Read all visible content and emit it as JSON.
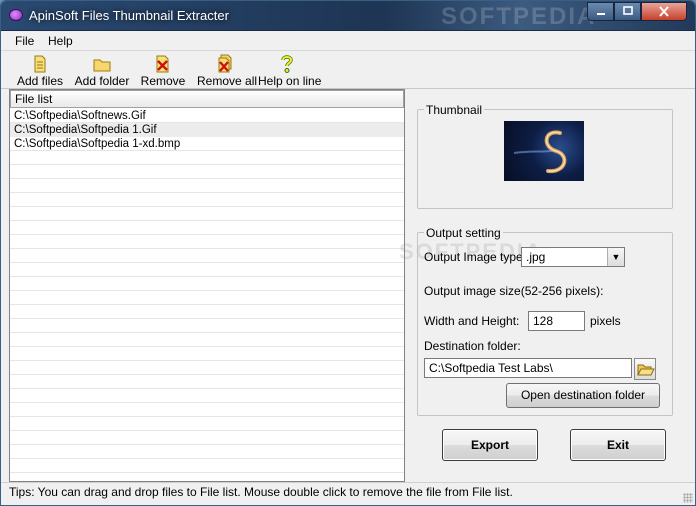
{
  "window": {
    "title": "ApinSoft Files Thumbnail Extracter",
    "watermark": "SOFTPEDIA"
  },
  "menu": {
    "items": [
      {
        "label": "File"
      },
      {
        "label": "Help"
      }
    ]
  },
  "toolbar": {
    "add_files": "Add files",
    "add_folder": "Add folder",
    "remove": "Remove",
    "remove_all": "Remove all",
    "help_online": "Help on line"
  },
  "filelist": {
    "header": "File list",
    "rows": [
      "C:\\Softpedia\\Softnews.Gif",
      "C:\\Softpedia\\Softpedia 1.Gif",
      "C:\\Softpedia\\Softpedia 1-xd.bmp"
    ]
  },
  "thumbnail": {
    "title": "Thumbnail"
  },
  "output": {
    "title": "Output setting",
    "image_type_label": "Output Image type:",
    "image_type_value": ".jpg",
    "size_label": "Output image size(52-256 pixels):",
    "wh_label": "Width and Height:",
    "wh_value": "128",
    "pixels_label": "pixels",
    "dest_label": "Destination folder:",
    "dest_value": "C:\\Softpedia Test Labs\\",
    "open_dest": "Open destination folder"
  },
  "actions": {
    "export": "Export",
    "exit": "Exit"
  },
  "status": {
    "tip": "Tips: You can drag and drop files to File list. Mouse double click to remove the file from File list."
  }
}
